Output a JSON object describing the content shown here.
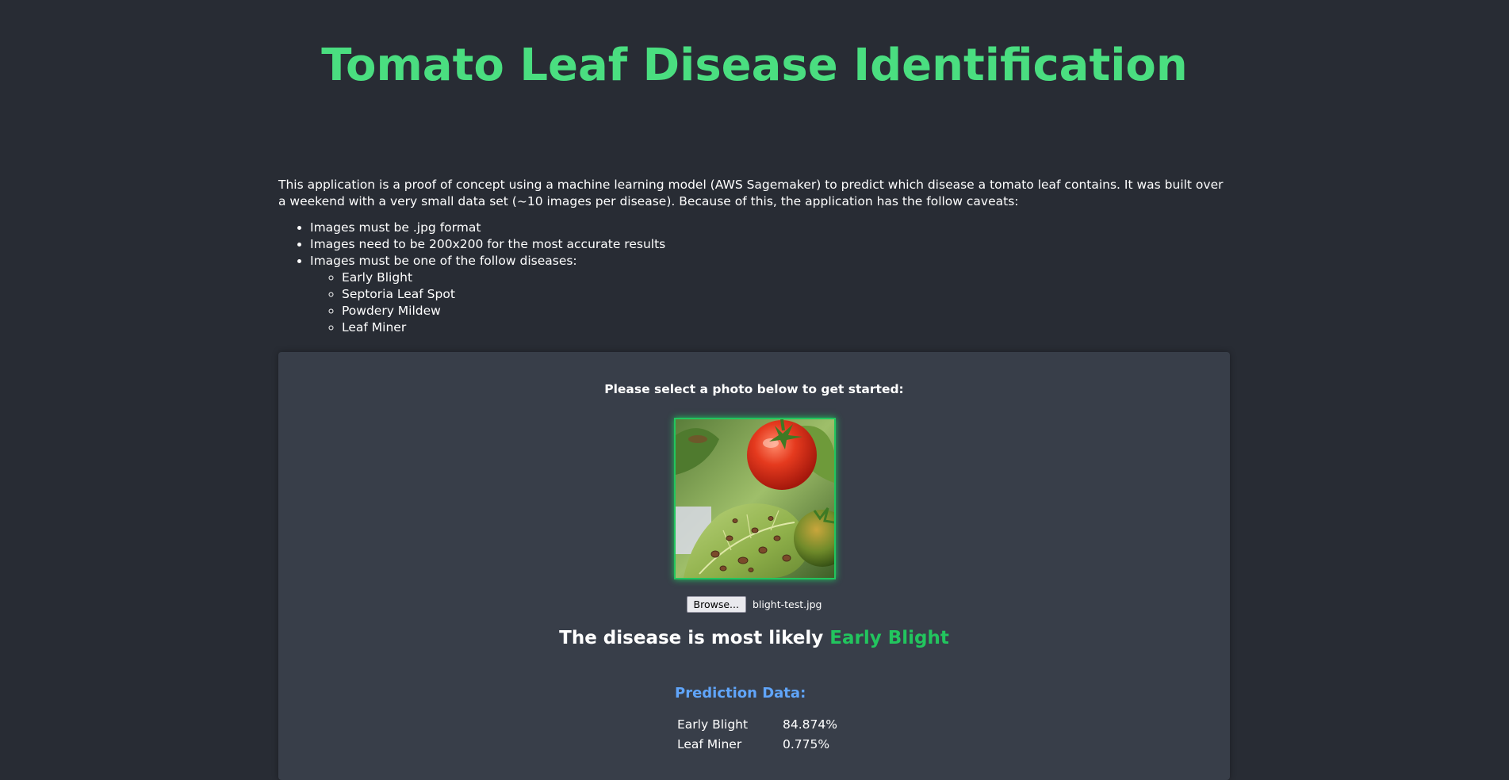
{
  "title": "Tomato Leaf Disease Identification",
  "intro": "This application is a proof of concept using a machine learning model (AWS Sagemaker) to predict which disease a tomato leaf contains. It was built over a weekend with a very small data set (~10 images per disease). Because of this, the application has the follow caveats:",
  "caveats": [
    "Images must be .jpg format",
    "Images need to be 200x200 for the most accurate results",
    "Images must be one of the follow diseases:"
  ],
  "diseases": [
    "Early Blight",
    "Septoria Leaf Spot",
    "Powdery Mildew",
    "Leaf Miner"
  ],
  "panel": {
    "prompt": "Please select a photo below to get started:",
    "browse_label": "Browse...",
    "file_name": "blight-test.jpg",
    "result_prefix": "The disease is most likely",
    "result_disease": "Early Blight",
    "prediction_title": "Prediction Data:",
    "predictions": [
      {
        "label": "Early Blight",
        "value": "84.874%"
      },
      {
        "label": "Leaf Miner",
        "value": "0.775%"
      }
    ]
  },
  "colors": {
    "background": "#282c34",
    "panel": "#383e49",
    "title": "#4ade80",
    "accent_green": "#22c55e",
    "accent_blue": "#60a5fa"
  }
}
